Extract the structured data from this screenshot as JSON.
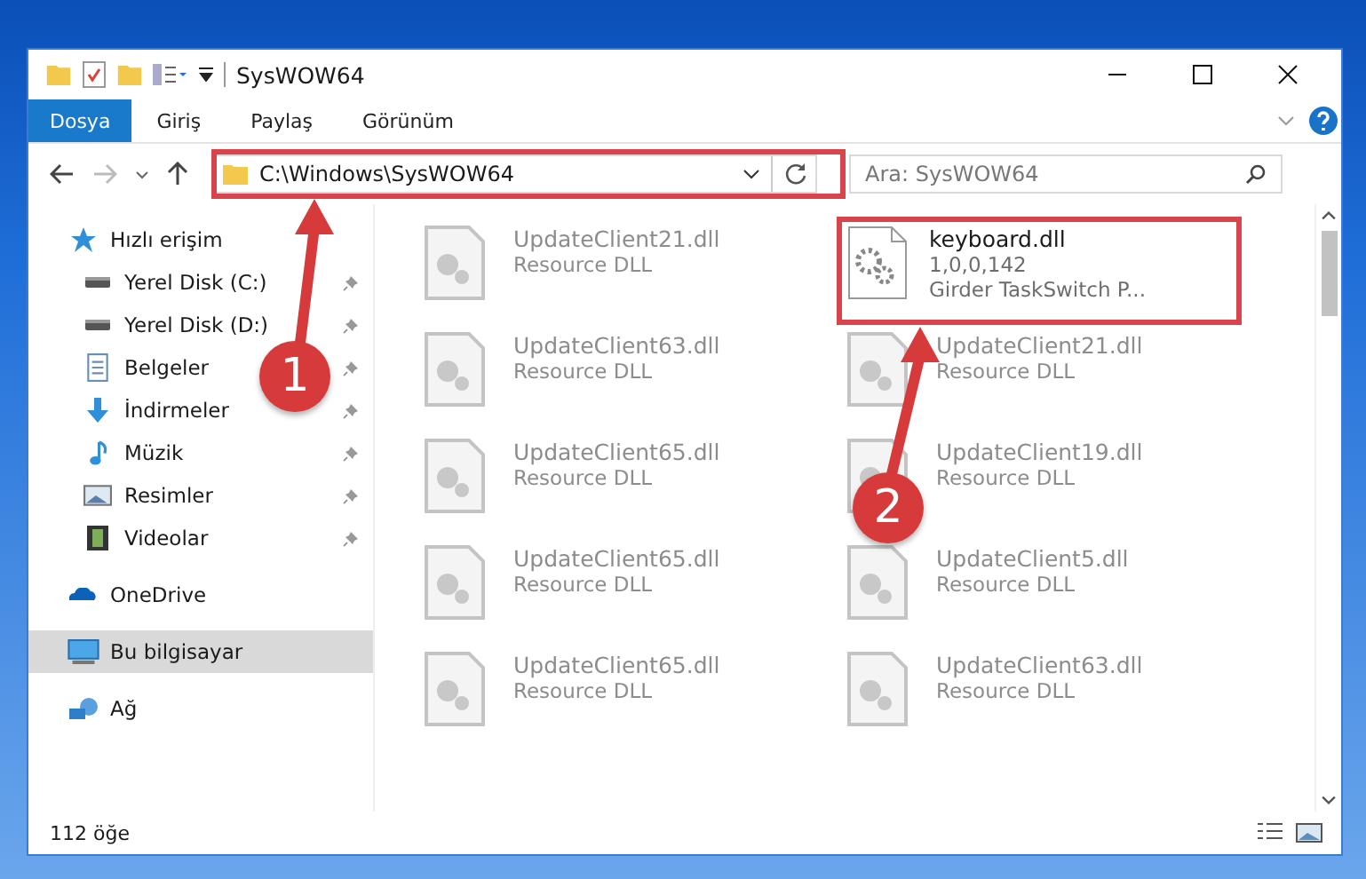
{
  "window": {
    "title": "SysWOW64"
  },
  "ribbon_tabs": [
    {
      "label": "Dosya",
      "selected": true
    },
    {
      "label": "Giriş",
      "selected": false
    },
    {
      "label": "Paylaş",
      "selected": false
    },
    {
      "label": "Görünüm",
      "selected": false
    }
  ],
  "address": {
    "path": "C:\\Windows\\SysWOW64"
  },
  "search": {
    "placeholder": "Ara: SysWOW64"
  },
  "sidebar": {
    "items": [
      {
        "label": "Hızlı erişim",
        "pinned": false,
        "selected": false,
        "children": [
          {
            "label": "Yerel Disk (C:)",
            "pinned": true,
            "selected": false
          },
          {
            "label": "Yerel Disk (D:)",
            "pinned": true,
            "selected": false
          },
          {
            "label": "Belgeler",
            "pinned": true,
            "selected": false
          },
          {
            "label": "İndirmeler",
            "pinned": true,
            "selected": false
          },
          {
            "label": "Müzik",
            "pinned": true,
            "selected": false
          },
          {
            "label": "Resimler",
            "pinned": true,
            "selected": false
          },
          {
            "label": "Videolar",
            "pinned": true,
            "selected": false
          }
        ]
      },
      {
        "label": "OneDrive",
        "pinned": false,
        "selected": false
      },
      {
        "label": "Bu bilgisayar",
        "pinned": false,
        "selected": true
      },
      {
        "label": "Ağ",
        "pinned": false,
        "selected": false
      }
    ]
  },
  "files": [
    {
      "kind": "dimmed",
      "name": "UpdateClient21.dll",
      "type": "Resource DLL"
    },
    {
      "kind": "highlighted",
      "name": "keyboard.dll",
      "version": "1,0,0,142",
      "type": "Girder TaskSwitch P..."
    },
    {
      "kind": "dimmed",
      "name": "UpdateClient63.dll",
      "type": "Resource DLL"
    },
    {
      "kind": "dimmed",
      "name": "UpdateClient21.dll",
      "type": "Resource DLL"
    },
    {
      "kind": "dimmed",
      "name": "UpdateClient65.dll",
      "type": "Resource DLL"
    },
    {
      "kind": "dimmed",
      "name": "UpdateClient19.dll",
      "type": "Resource DLL"
    },
    {
      "kind": "dimmed",
      "name": "UpdateClient65.dll",
      "type": "Resource DLL"
    },
    {
      "kind": "dimmed",
      "name": "UpdateClient5.dll",
      "type": "Resource DLL"
    },
    {
      "kind": "dimmed",
      "name": "UpdateClient65.dll",
      "type": "Resource DLL"
    },
    {
      "kind": "dimmed",
      "name": "UpdateClient63.dll",
      "type": "Resource DLL"
    }
  ],
  "annotations": [
    {
      "number": "1"
    },
    {
      "number": "2"
    }
  ],
  "status_bar": {
    "count": "112 öğe"
  }
}
